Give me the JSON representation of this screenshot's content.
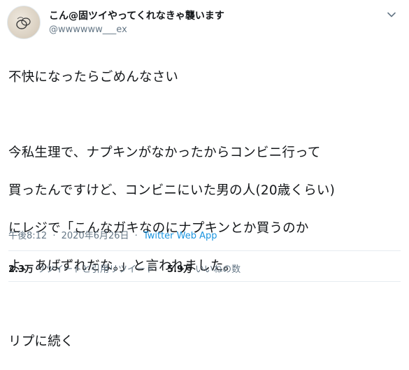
{
  "user": {
    "display_name": "こん@固ツイやってくれなきゃ襲います",
    "handle": "@wwwwww___ex",
    "avatar_icon": "avatar-ring-icon"
  },
  "tweet": {
    "lines": [
      "不快になったらごめんなさい",
      "",
      "今私生理で、ナプキンがなかったからコンビニ行って",
      "買ったんですけど、コンビニにいた男の人(20歳くらい)",
      "にレジで「こんなガキなのにナプキンとか買うのか",
      "よ、あばずれだな。」と言われました。",
      "",
      "リプに続く"
    ]
  },
  "meta": {
    "time": "午後8:12",
    "separator": "·",
    "date": "2020年6月26日",
    "source": "Twitter Web App"
  },
  "stats": {
    "retweets_count": "2.3万",
    "retweets_label": "リツイートと引用リツイート",
    "likes_count": "5.9万",
    "likes_label": "いいねの数"
  },
  "colors": {
    "text": "#14171a",
    "secondary": "#657786",
    "link": "#1b95e0",
    "divider": "#e6ecf0"
  }
}
